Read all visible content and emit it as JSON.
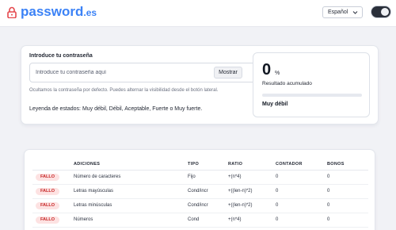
{
  "header": {
    "brand_name": "password",
    "brand_tld": ".es",
    "language_selected": "Español",
    "theme_toggle_state": "dark",
    "lock_icon": "lock-icon",
    "chevron_icon": "chevron-down-icon"
  },
  "main": {
    "input_label": "Introduce tu contraseña",
    "input_placeholder": "Introduce tu contraseña aquí",
    "input_value": "",
    "show_button": "Mostrar",
    "hint": "Ocultamos la contraseña por defecto. Puedes alternar la visibilidad desde el botón lateral.",
    "legend": "Leyenda de estados: Muy débil, Débil, Aceptable, Fuerte o Muy fuerte."
  },
  "score": {
    "value": "0",
    "unit": "%",
    "label": "Resultado acumulado",
    "progress_fraction": 0,
    "strength": "Muy débil",
    "progress_color": "#ef4444"
  },
  "table": {
    "headers": [
      "",
      "ADICIONES",
      "TIPO",
      "RATIO",
      "CONTADOR",
      "BONOS"
    ],
    "rows": [
      {
        "status": "FALLO",
        "addition": "Número de caracteres",
        "type": "Fijo",
        "ratio": "+(n*4)",
        "count": "0",
        "bonus": "0"
      },
      {
        "status": "FALLO",
        "addition": "Letras mayúsculas",
        "type": "Cond/incr",
        "ratio": "+((len-n)*2)",
        "count": "0",
        "bonus": "0"
      },
      {
        "status": "FALLO",
        "addition": "Letras minúsculas",
        "type": "Cond/incr",
        "ratio": "+((len-n)*2)",
        "count": "0",
        "bonus": "0"
      },
      {
        "status": "FALLO",
        "addition": "Números",
        "type": "Cond",
        "ratio": "+(n*4)",
        "count": "0",
        "bonus": "0"
      }
    ]
  },
  "colors": {
    "brand": "#3b82f6",
    "fail_badge_bg": "#fde2e2",
    "fail_badge_text": "#c62828",
    "background": "#f1f2f6"
  }
}
